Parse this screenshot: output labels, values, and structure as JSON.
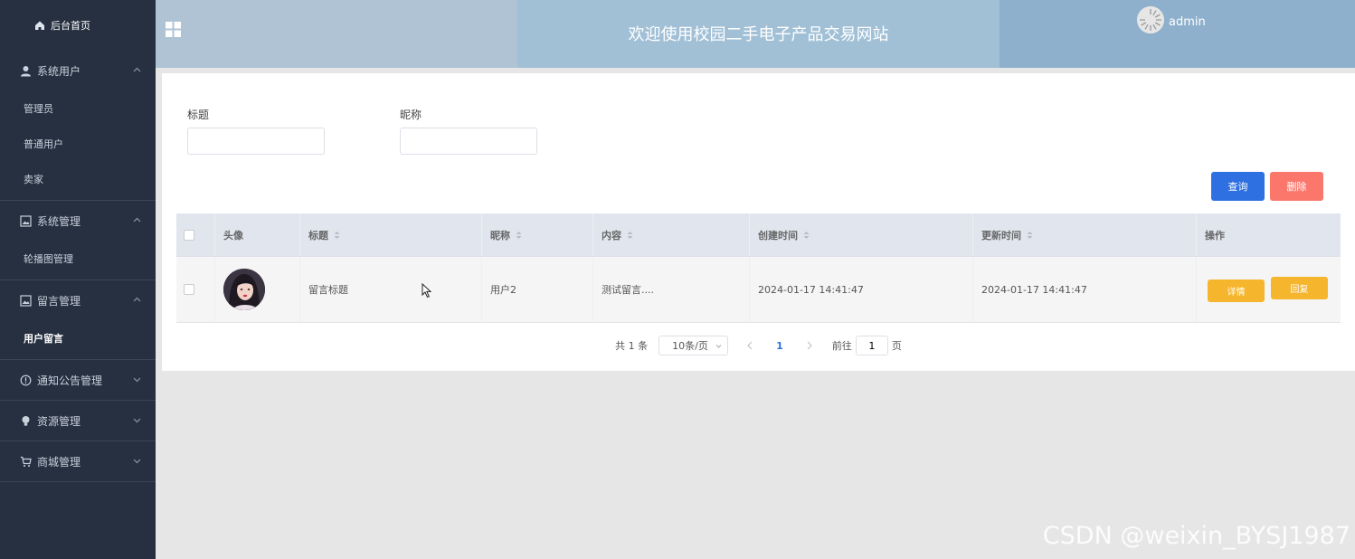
{
  "sidebar": {
    "home": {
      "label": "后台首页",
      "icon": "home-icon"
    },
    "groups": [
      {
        "label": "系统用户",
        "icon": "user-icon",
        "expanded": true,
        "items": [
          "管理员",
          "普通用户",
          "卖家"
        ]
      },
      {
        "label": "系统管理",
        "icon": "image-icon",
        "expanded": true,
        "items": [
          "轮播图管理"
        ]
      },
      {
        "label": "留言管理",
        "icon": "image-icon",
        "expanded": true,
        "items": [
          "用户留言"
        ],
        "active_item": "用户留言"
      },
      {
        "label": "通知公告管理",
        "icon": "info-circle-icon",
        "expanded": false
      },
      {
        "label": "资源管理",
        "icon": "bulb-icon",
        "expanded": false
      },
      {
        "label": "商城管理",
        "icon": "cart-icon",
        "expanded": false
      }
    ]
  },
  "header": {
    "title": "欢迎使用校园二手电子产品交易网站",
    "username": "admin"
  },
  "filters": {
    "title_label": "标题",
    "title_value": "",
    "nickname_label": "昵称",
    "nickname_value": ""
  },
  "toolbar": {
    "query_label": "查询",
    "delete_label": "删除",
    "query_color": "#2e70e1",
    "delete_color": "#fb776c"
  },
  "table": {
    "headers": [
      "头像",
      "标题",
      "昵称",
      "内容",
      "创建时间",
      "更新时间",
      "操作"
    ],
    "rows": [
      {
        "title": "留言标题",
        "nickname": "用户2",
        "content": "测试留言....",
        "created": "2024-01-17 14:41:47",
        "updated": "2024-01-17 14:41:47",
        "detail_label": "详情",
        "reply_label": "回复"
      }
    ]
  },
  "pagination": {
    "total_text": "共 1 条",
    "page_size": "10条/页",
    "current_page": "1",
    "goto_prefix": "前往",
    "goto_value": "1",
    "goto_suffix": "页"
  },
  "watermark": "CSDN @weixin_BYSJ1987"
}
